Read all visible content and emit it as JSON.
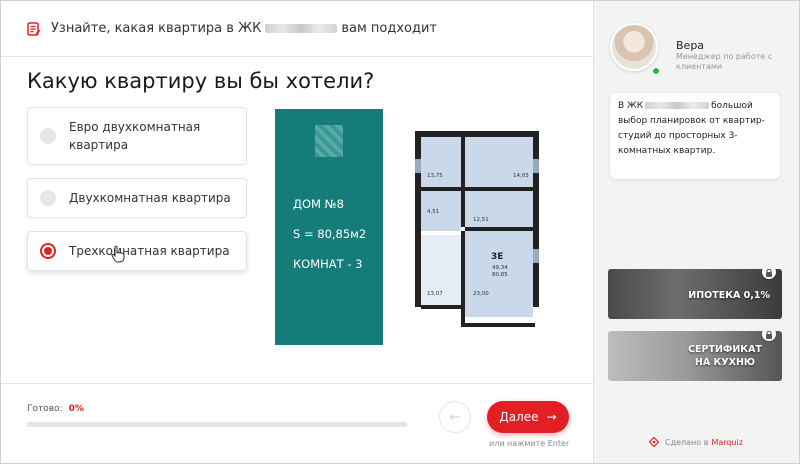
{
  "header": {
    "text_before": "Узнайте, какая квартира в ЖК",
    "text_after": "вам подходит",
    "icon": "quiz-list-icon"
  },
  "question": "Какую квартиру вы бы хотели?",
  "options": [
    {
      "label": "Евро двухкомнатная квартира",
      "selected": false
    },
    {
      "label": "Двухкомнатная квартира",
      "selected": false
    },
    {
      "label": "Трехкомнатная квартира",
      "selected": true
    }
  ],
  "plan": {
    "house": "ДОМ №8",
    "area": "S = 80,85м2",
    "rooms": "КОМНАТ - 3",
    "room_labels": {
      "r1": "13,75",
      "r2": "14,03",
      "r3": "4,51",
      "r4": "12,51",
      "r5_code": "3Е",
      "r5_a": "49,34",
      "r5_b": "80,85",
      "r6": "13,07",
      "r7": "23,00"
    }
  },
  "footer": {
    "ready_label": "Готово:",
    "ready_pct": "0%",
    "progress": 0,
    "next_label": "Далее",
    "hint": "или нажмите Enter"
  },
  "manager": {
    "name": "Вера",
    "role": "Менеджер по работе с клиентами",
    "message_before": "В ЖК",
    "message_after": "большой выбор планировок от квартир-студий до просторных 3-комнатных квартир."
  },
  "bonuses": [
    {
      "label": "ИПОТЕКА 0,1%"
    },
    {
      "label": "СЕРТИФИКАТ НА КУХНЮ"
    }
  ],
  "made_by": {
    "text": "Сделано в",
    "brand": "Marquiz"
  },
  "colors": {
    "accent": "#e31e24",
    "teal": "#147d7a",
    "online": "#2bb24c"
  }
}
